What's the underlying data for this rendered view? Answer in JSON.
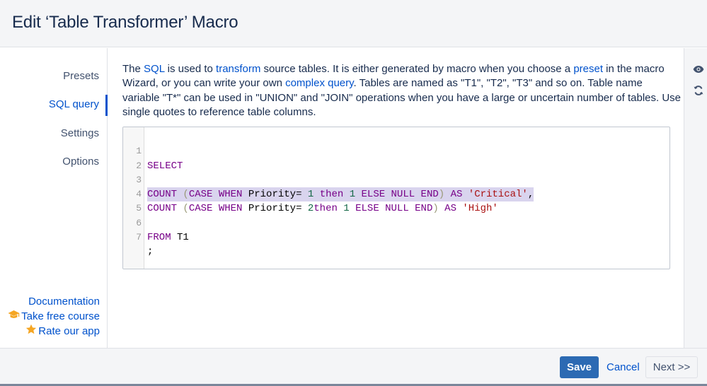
{
  "dialog": {
    "title": "Edit ‘Table Transformer’ Macro"
  },
  "sidebar": {
    "items": [
      {
        "label": "Presets",
        "active": false
      },
      {
        "label": "SQL query",
        "active": true
      },
      {
        "label": "Settings",
        "active": false
      },
      {
        "label": "Options",
        "active": false
      }
    ],
    "links": [
      {
        "label": "Documentation",
        "icon": ""
      },
      {
        "label": "Take free course",
        "icon": "graduation-cap-icon"
      },
      {
        "label": "Rate our app",
        "icon": "star-icon"
      }
    ]
  },
  "description": {
    "t1": "The ",
    "sql_link": "SQL",
    "t2": " is used to ",
    "transform_link": "transform",
    "t3": " source tables. It is either generated by macro when you choose a ",
    "preset_link": "preset",
    "t4": " in the macro Wizard, or you can write your own ",
    "complex_link": "complex query",
    "t5": ". Tables are named as \"T1\", \"T2\", \"T3\" and so on. Table name variable \"T*\" can be used in \"UNION\" and \"JOIN\" operations when you have a large or uncertain number of tables. Use single quotes to reference table columns."
  },
  "editor": {
    "line_numbers": [
      "1",
      "2",
      "3",
      "4",
      "5",
      "6",
      "7"
    ],
    "line1": {
      "kw": "SELECT"
    },
    "line3": {
      "count": "COUNT",
      "paren_open": " (",
      "case": "CASE",
      "sp1": " ",
      "when": "WHEN",
      "field": " Priority= ",
      "n1": "1",
      "sp2": " ",
      "then": "then",
      "sp3": " ",
      "n2": "1",
      "sp4": " ",
      "else": "ELSE",
      "sp5": " ",
      "null": "NULL",
      "sp6": " ",
      "end": "END",
      "paren_close": ")",
      "sp7": " ",
      "as": "AS",
      "sp8": " ",
      "alias": "'Critical'",
      "tail": ","
    },
    "line4": {
      "count": "COUNT",
      "paren_open": " (",
      "case": "CASE",
      "sp1": " ",
      "when": "WHEN",
      "field": " Priority= ",
      "n1": "2",
      "then": "then",
      "sp3": " ",
      "n2": "1",
      "sp4": " ",
      "else": "ELSE",
      "sp5": " ",
      "null": "NULL",
      "sp6": " ",
      "end": "END",
      "paren_close": ")",
      "sp7": " ",
      "as": "AS",
      "sp8": " ",
      "alias": "'High'"
    },
    "line6": {
      "from": "FROM",
      "table": " T1"
    },
    "line7": {
      "semi": ";"
    }
  },
  "rightbar": {
    "icons": [
      "eye-icon",
      "refresh-icon"
    ]
  },
  "footer": {
    "save_label": "Save",
    "cancel_label": "Cancel",
    "next_label": "Next >>"
  },
  "colors": {
    "accent": "#0052cc",
    "primary_button": "#2c6ab3",
    "keyword": "#770088",
    "string": "#aa1111",
    "number": "#116644",
    "selection": "#d9d4ee"
  }
}
